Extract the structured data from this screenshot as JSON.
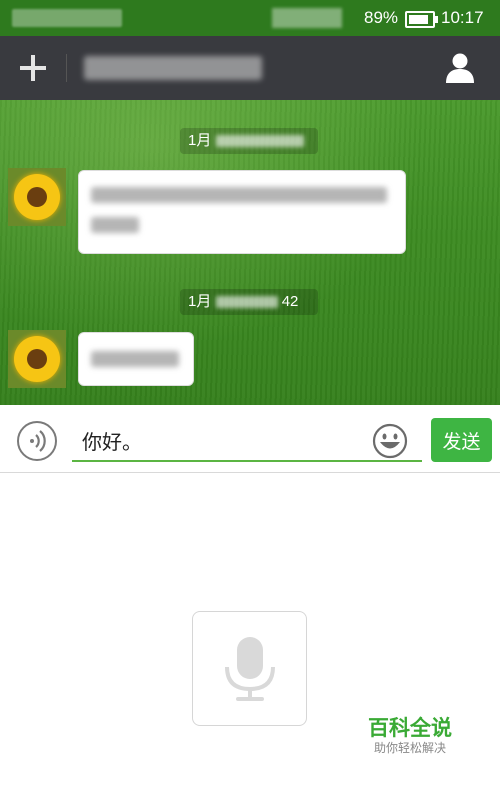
{
  "status_bar": {
    "network": "2G",
    "battery_percent": "89%",
    "battery_level": 0.89,
    "time": "10:17"
  },
  "header": {
    "add_icon": "plus-icon",
    "profile_icon": "person-icon"
  },
  "chat": {
    "messages": [
      {
        "timestamp": "1月",
        "sender": "other"
      },
      {
        "timestamp": "1月",
        "timestamp_suffix": "42",
        "sender": "other"
      }
    ]
  },
  "input": {
    "value": "你好。",
    "voice_icon": "voice-wave-icon",
    "emoji_icon": "smiley-icon",
    "send_label": "发送"
  },
  "voice_panel": {
    "mic_icon": "microphone-icon"
  },
  "watermark": {
    "title": "百科全说",
    "subtitle": "助你轻松解决"
  },
  "colors": {
    "status_bar": "#2e7a1e",
    "header": "#393a3f",
    "accent": "#3eb543"
  }
}
